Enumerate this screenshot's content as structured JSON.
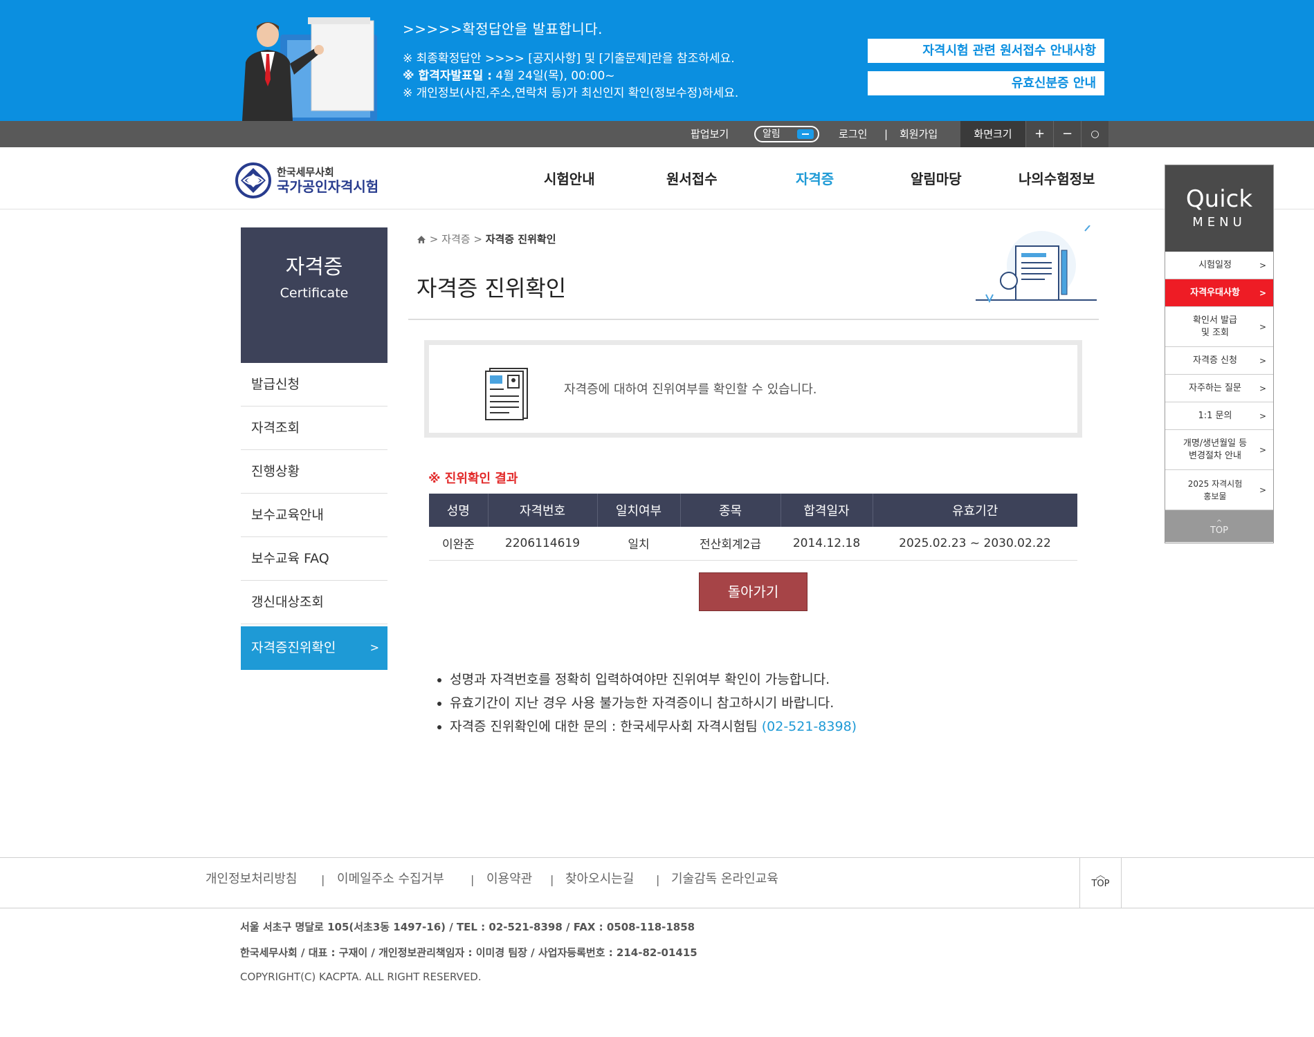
{
  "banner": {
    "title": ">>>>>확정답안을 발표합니다.",
    "line1": "※ 최종확정답안 >>>> [공지사항] 및 [기출문제]란을 참조하세요.",
    "line2_strong": "※ 합격자발표일 :",
    "line2_rest": " 4월 24일(목), 00:00~",
    "line3": "※ 개인정보(사진,주소,연락처 등)가 최신인지 확인(정보수정)하세요.",
    "btn1": "자격시험 관련 원서접수 안내사항",
    "btn2": "유효신분증 안내"
  },
  "utilbar": {
    "popup": "팝업보기",
    "alarm": "알림",
    "login": "로그인",
    "sep": "|",
    "join": "회원가입",
    "screen_size": "화면크기",
    "plus": "+",
    "minus": "−",
    "reset": "○"
  },
  "logo": {
    "line1": "한국세무사회",
    "line2": "국가공인자격시험"
  },
  "gnb": [
    "시험안내",
    "원서접수",
    "자격증",
    "알림마당",
    "나의수험정보"
  ],
  "quick": {
    "title1": "Quick",
    "title2": "MENU",
    "items": [
      {
        "label": "시험일정",
        "arrow": ">"
      },
      {
        "label": "자격우대사항",
        "arrow": ">"
      },
      {
        "label": "확인서 발급\n및 조회",
        "arrow": ">"
      },
      {
        "label": "자격증 신청",
        "arrow": ">"
      },
      {
        "label": "자주하는 질문",
        "arrow": ">"
      },
      {
        "label": "1:1 문의",
        "arrow": ">"
      },
      {
        "label": "개명/생년월일 등\n변경절차 안내",
        "arrow": ">"
      },
      {
        "label": "2025 자격시험\n홍보물",
        "arrow": ">"
      }
    ],
    "top": "TOP"
  },
  "lnb": {
    "title": "자격증",
    "subtitle": "Certificate",
    "items": [
      "발급신청",
      "자격조회",
      "진행상황",
      "보수교육안내",
      "보수교육 FAQ",
      "갱신대상조회",
      "자격증진위확인"
    ],
    "active_arrow": ">"
  },
  "breadcrumb": {
    "sep": ">",
    "parent": "자격증",
    "current": "자격증 진위확인"
  },
  "page_title": "자격증 진위확인",
  "infobox_text": "자격증에 대하여 진위여부를 확인할 수 있습니다.",
  "result": {
    "title": "※ 진위확인 결과",
    "headers": [
      "성명",
      "자격번호",
      "일치여부",
      "종목",
      "합격일자",
      "유효기간"
    ],
    "row": [
      "이완준",
      "2206114619",
      "일치",
      "전산회계2급",
      "2014.12.18",
      "2025.02.23 ~ 2030.02.22"
    ],
    "back": "돌아가기"
  },
  "notes": {
    "n1": "성명과 자격번호를 정확히 입력하여야만 진위여부 확인이 가능합니다.",
    "n2": "유효기간이 지난 경우 사용 불가능한 자격증이니 참고하시기 바랍니다.",
    "n3": "자격증 진위확인에 대한 문의 : 한국세무사회 자격시험팀",
    "n3_tel": "(02-521-8398)"
  },
  "footer": {
    "links": [
      "개인정보처리방침",
      "이메일주소 수집거부",
      "이용약관",
      "찾아오시는길",
      "기술감독 온라인교육"
    ],
    "sep": "|",
    "top": "TOP",
    "addr1": "서울 서초구 명달로 105(서초3동 1497-16) / TEL : 02-521-8398 / FAX : 0508-118-1858",
    "addr2": "한국세무사회 / 대표 : 구재이 / 개인정보관리책임자 : 이미경 팀장 / 사업자등록번호 : 214-82-01415",
    "addr3": "COPYRIGHT(C) KACPTA. ALL RIGHT RESERVED."
  },
  "colors": {
    "banner": "#0b8fe0",
    "navy": "#3d4259",
    "accent": "#1e9ad6",
    "red": "#ee1c25",
    "back_button": "#a64447"
  }
}
